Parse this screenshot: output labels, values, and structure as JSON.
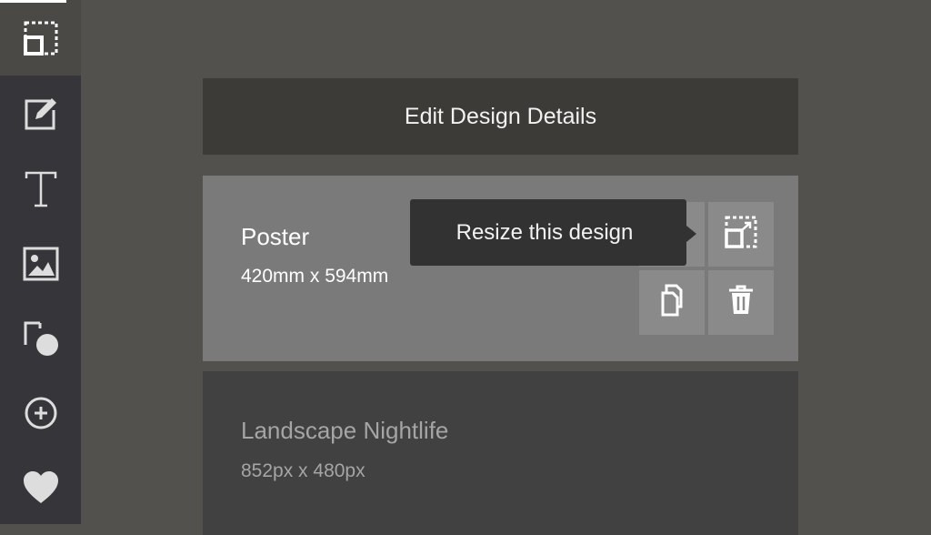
{
  "sidebar": {
    "items": [
      {
        "name": "resize",
        "icon": "resize-icon"
      },
      {
        "name": "edit",
        "icon": "edit-pencil-icon"
      },
      {
        "name": "text",
        "icon": "text-icon"
      },
      {
        "name": "image",
        "icon": "image-icon"
      },
      {
        "name": "shapes",
        "icon": "shapes-icon"
      },
      {
        "name": "add",
        "icon": "plus-circle-icon"
      },
      {
        "name": "favorites",
        "icon": "heart-icon"
      }
    ]
  },
  "header": {
    "title": "Edit Design Details"
  },
  "designs": [
    {
      "title": "Poster",
      "size": "420mm x 594mm",
      "selected": true
    },
    {
      "title": "Landscape Nightlife",
      "size": "852px x 480px",
      "selected": false
    }
  ],
  "actions": {
    "download_icon": "cloud-download-icon",
    "resize_icon": "resize-icon",
    "duplicate_icon": "duplicate-icon",
    "delete_icon": "trash-icon"
  },
  "tooltip": {
    "text": "Resize this design"
  },
  "colors": {
    "background": "#53514d",
    "sidebar": "#36363a",
    "header": "#3d3b38",
    "selected_card": "#7a7a7a",
    "card": "#414141",
    "tooltip": "#323232"
  }
}
